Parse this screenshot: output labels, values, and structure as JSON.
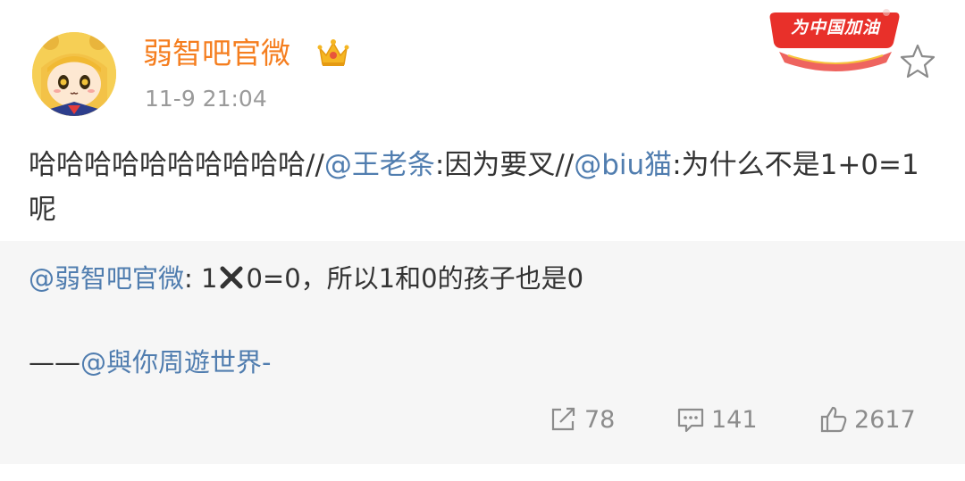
{
  "header": {
    "username": "弱智吧官微",
    "timestamp": "11-9 21:04",
    "badge_text": "为中国加油"
  },
  "icons": {
    "avatar": "anime-girl-avatar",
    "crown": "crown-icon",
    "star": "star-icon",
    "repost": "repost-icon",
    "comment": "comment-icon",
    "like": "thumbs-up-icon",
    "x_mark": "x-mark-icon"
  },
  "post": {
    "text_1": "哈哈哈哈哈哈哈哈哈哈//",
    "mention_1": "@王老条",
    "text_2": ":因为要叉//",
    "mention_2": "@biu猫",
    "text_3": ":为什么不是1+0=1呢"
  },
  "retweet": {
    "author": "@弱智吧官微",
    "colon": ": 1",
    "text_after": "0=0，所以1和0的孩子也是0",
    "dash": "——",
    "source": "@與你周遊世界-"
  },
  "actions": {
    "repost_count": "78",
    "comment_count": "141",
    "like_count": "2617"
  },
  "colors": {
    "username": "#f57e1f",
    "mention": "#507daf",
    "retweet_bg": "#f6f6f6",
    "badge": "#e8302a"
  }
}
